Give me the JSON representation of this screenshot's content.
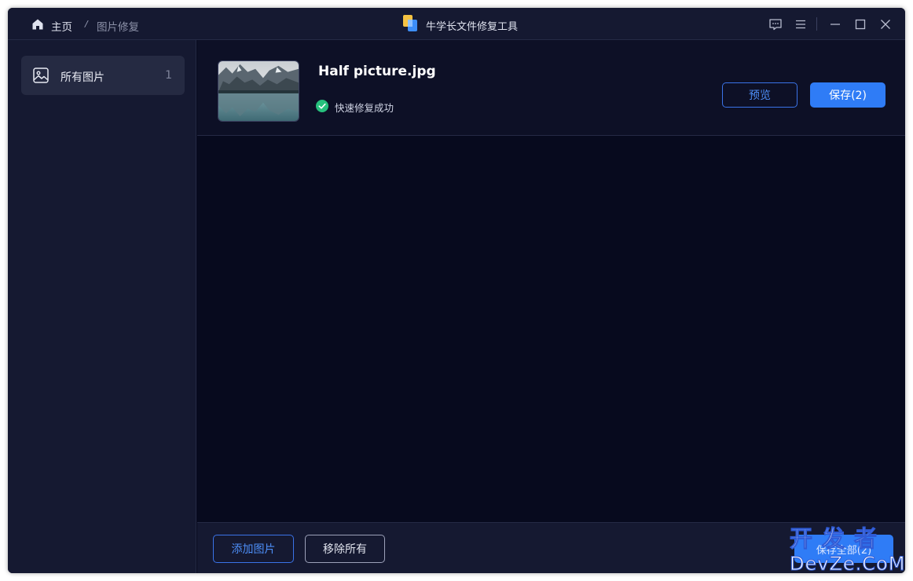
{
  "titlebar": {
    "breadcrumb": {
      "home_label": "主页",
      "separator": "/",
      "current": "图片修复"
    },
    "app_title": "牛学长文件修复工具",
    "icons": [
      "feedback-icon",
      "menu-icon",
      "minimize-icon",
      "maximize-icon",
      "close-icon"
    ]
  },
  "sidebar": {
    "items": [
      {
        "label": "所有图片",
        "count": "1",
        "icon": "image-icon"
      }
    ]
  },
  "file": {
    "name": "Half picture.jpg",
    "status": "快速修复成功",
    "status_icon": "check-circle-icon",
    "preview_label": "预览",
    "save_label": "保存(2)"
  },
  "footer": {
    "add_label": "添加图片",
    "remove_label": "移除所有",
    "save_all_label": "保存全部(2)"
  },
  "watermark": {
    "line1": "开发者",
    "line2": "DevZe.CoM"
  },
  "colors": {
    "background": "#070a1e",
    "panel": "#151931",
    "accent": "#2f7cf6",
    "success": "#27c07d"
  }
}
